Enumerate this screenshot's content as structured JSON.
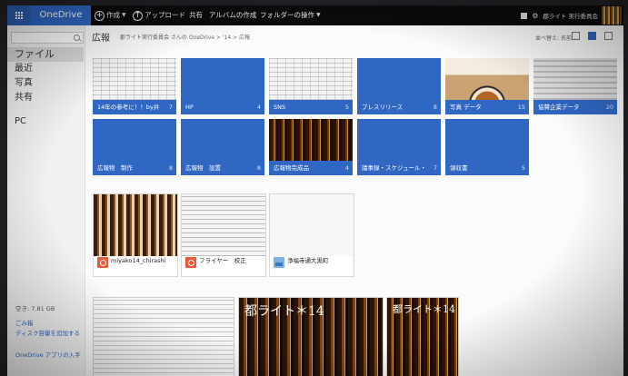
{
  "app": {
    "brand": "OneDrive"
  },
  "toolbar": {
    "create": "作成",
    "upload": "アップロード",
    "share": "共有",
    "create_album": "アルバムの作成",
    "folder_actions": "フォルダーの操作",
    "user_name": "郡ライト 実行委員会"
  },
  "sidebar": {
    "search_placeholder": "",
    "items": [
      "ファイル",
      "最近",
      "写真",
      "共有",
      "PC"
    ],
    "storage": "空き: 7.81 GB",
    "recycle_bin": "ごみ箱",
    "add_storage": "ディスク容量を追加する",
    "get_apps": "OneDrive アプリの入手"
  },
  "main": {
    "title": "広報",
    "breadcrumb": "郡ライト実行委員会 さんの OneDrive > '14 > 広報",
    "sort_label": "並べ替え: 名前 ⌄"
  },
  "folders": [
    {
      "label": "14年の参考に！！by井",
      "count": "7",
      "style": "doc"
    },
    {
      "label": "HP",
      "count": "4",
      "style": "plain"
    },
    {
      "label": "SNS",
      "count": "5",
      "style": "doc"
    },
    {
      "label": "プレスリリース",
      "count": "8",
      "style": "plain"
    },
    {
      "label": "写真 データ",
      "count": "15",
      "style": "fan"
    },
    {
      "label": "協賛企業データ",
      "count": "20",
      "style": "grey"
    },
    {
      "label": "広報物　制作",
      "count": "8",
      "style": "plain"
    },
    {
      "label": "広報物　設置",
      "count": "8",
      "style": "plain"
    },
    {
      "label": "広報物完成品",
      "count": "4",
      "style": "dark"
    },
    {
      "label": "議事録・スケジュール・・",
      "count": "7",
      "style": "plain"
    },
    {
      "label": "領収書",
      "count": "5",
      "style": "plain"
    }
  ],
  "files": [
    {
      "name": "miyako14_chirashi",
      "icon": "pdf-icon"
    },
    {
      "name": "フライヤー　校正",
      "icon": "pdf-icon"
    },
    {
      "name": "浄福寺通大黒町",
      "icon": "image-icon"
    }
  ],
  "posters": [
    {
      "title": ""
    },
    {
      "title": "都ライト＊14"
    },
    {
      "title": "都ライト＊14"
    }
  ]
}
